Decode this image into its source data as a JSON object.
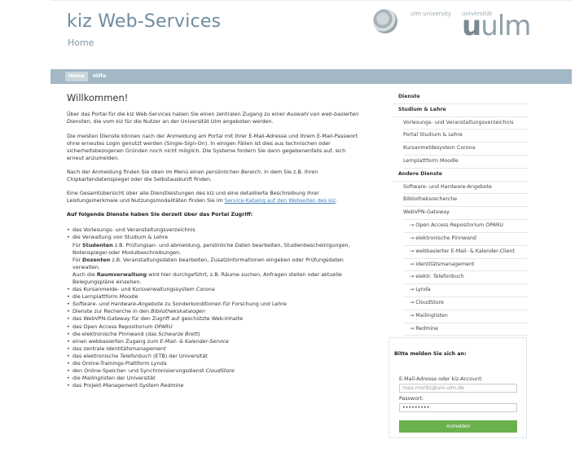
{
  "header": {
    "title": "kiz Web-Services",
    "subtitle": "Home",
    "logo_text_small_1": "ulm university",
    "logo_text_small_2": "universität",
    "logo_u": "u",
    "logo_ulm": "ulm"
  },
  "nav": {
    "home": "Home",
    "hilfe": "Hilfe"
  },
  "main": {
    "heading": "Willkommen!",
    "p1_a": "Über das Portal für die kiz Web-Services haben Sie einen zentralen Zugang zu einer ",
    "p1_em": "Auswahl von web-basierten Diensten",
    "p1_b": ", die vom kiz für die Nutzer an der Universität Ulm angeboten werden.",
    "p2": "Die meisten Dienste können nach der Anmeldung am Portal mit Ihrer E-Mail-Adresse und Ihrem E-Mail-Passwort ohne erneutes Login genutzt werden (Single-Sign-On). In einigen Fällen ist dies aus technischen oder sicherheitsbezogenen Gründen noch nicht möglich. Die Systeme fordern Sie dann gegebenenfalls auf, sich erneut anzumelden.",
    "p3_a": "Nach der Anmeldung finden Sie oben im Menü einen ",
    "p3_em": "persönlichen Bereich",
    "p3_b": ", in dem Sie z.B. Ihren Chipkartendatenspiegel oder die Selbstauskunft finden.",
    "p4_a": "Eine Gesamtübersicht über alle Dienstleistungen des kiz und eine detaillierte Beschreibung ihrer Leistungsmerkmale und Nutzungsmodalitäten finden Sie im ",
    "p4_link": "Service-Katalog auf den Webseiten des kiz",
    "p4_b": ".",
    "services_heading": "Auf folgende Dienste haben Sie derzeit über das Portal Zugriff:",
    "li1": "das Vorlesungs- und Veranstaltungsverzeichnis",
    "li2": "die Verwaltung von Studium & Lehre",
    "li2_s1_a": "Für ",
    "li2_s1_b": "Studenten",
    "li2_s1_c": " z.B. Prüfungsan- und abmeldung, persönliche Daten bearbeiten, Studienbescheinigungen, Notenspiegel oder Modulbeschreibungen.",
    "li2_s2_a": "Für ",
    "li2_s2_b": "Dozenten",
    "li2_s2_c": " z.B. Veranstaltungsdaten bearbeiten, Zusatzinformationen eingeben oder Prüfungsdaten verwalten.",
    "li2_s3_a": "Auch die ",
    "li2_s3_b": "Raumverwaltung",
    "li2_s3_c": " wird hier durchgeführt, z.B. Räume suchen, Anfragen stellen oder aktuelle Belegungspläne einsehen.",
    "li3_a": "das Kursanmelde- und Kursverwaltungssystem ",
    "li3_em": "Corona",
    "li4_a": "die Lernplattform ",
    "li4_em": "Moodle",
    "li5_em": "Software- und Hardware-Angebote",
    "li5_b": " zu Sonderkonditionen für Forschung und Lehre",
    "li6_a": "Dienste zur Recherche in den ",
    "li6_em": "Bibliothekskatalogen",
    "li7_a": "das WebVPN-",
    "li7_em": "Gateway",
    "li7_b": " für den Zugriff auf geschützte Web-Inhalte",
    "li8_a": "das Open Access Repositorium ",
    "li8_em": "OPARU",
    "li9_a": "die elektronische Pinnwand (das ",
    "li9_em": "Schwarze Brett",
    "li9_b": ")",
    "li10_a": "einen webbasierten Zugang zum ",
    "li10_em": "E-Mail- & Kalender-Service",
    "li11_a": "das zentrale ",
    "li11_em": "Identitätsmanagement",
    "li12_a": "das elektronische ",
    "li12_em": "Telefonbuch",
    "li12_b": " (ETB) der Universität",
    "li13_a": "die Online-Trainings-Plattform ",
    "li13_em": "Lynda",
    "li14_a": "den Online-Speicher- und Synchronisierungsdienst ",
    "li14_em": "CloudStore",
    "li15_a": "die ",
    "li15_em": "Mailinglisten",
    "li15_b": " der Universität",
    "li16_a": "das Projekt-Management-System ",
    "li16_em": "Redmine"
  },
  "sidebar": {
    "heading": "Dienste",
    "group1": "Studium & Lehre",
    "g1_items": [
      "Vorlesungs- und Veranstaltungsverzeichnis",
      "Portal Studium & Lehre",
      "Kursanmeldesystem Corona",
      "Lernplattform Moodle"
    ],
    "group2": "Andere Dienste",
    "g2_items": [
      "Software- und Hardware-Angebote",
      "Bibliotheksrecherche",
      "WebVPN-Gateway"
    ],
    "g2_sub_items": [
      "→ Open Access Repositorium OPARU",
      "→ elektronische Pinnwand",
      "→ webbasierter E-Mail- & Kalender-Client",
      "→ Identitätsmanagement",
      "→ elektr. Telefonbuch",
      "→ Lynda",
      "→ CloudStore",
      "→ Mailinglisten",
      "→ Redmine"
    ]
  },
  "login": {
    "title": "Bitte melden Sie sich an:",
    "email_label": "E-Mail-Adresse oder kiz-Account:",
    "email_value": "max.moritz@uni-ulm.de",
    "password_label": "Passwort:",
    "password_value": "•••••••••",
    "submit": "Anmelden"
  },
  "colors": {
    "navbar": "#a3b7c4",
    "title": "#6e8ca0",
    "button": "#6ab04c",
    "link": "#3d7fb8"
  }
}
